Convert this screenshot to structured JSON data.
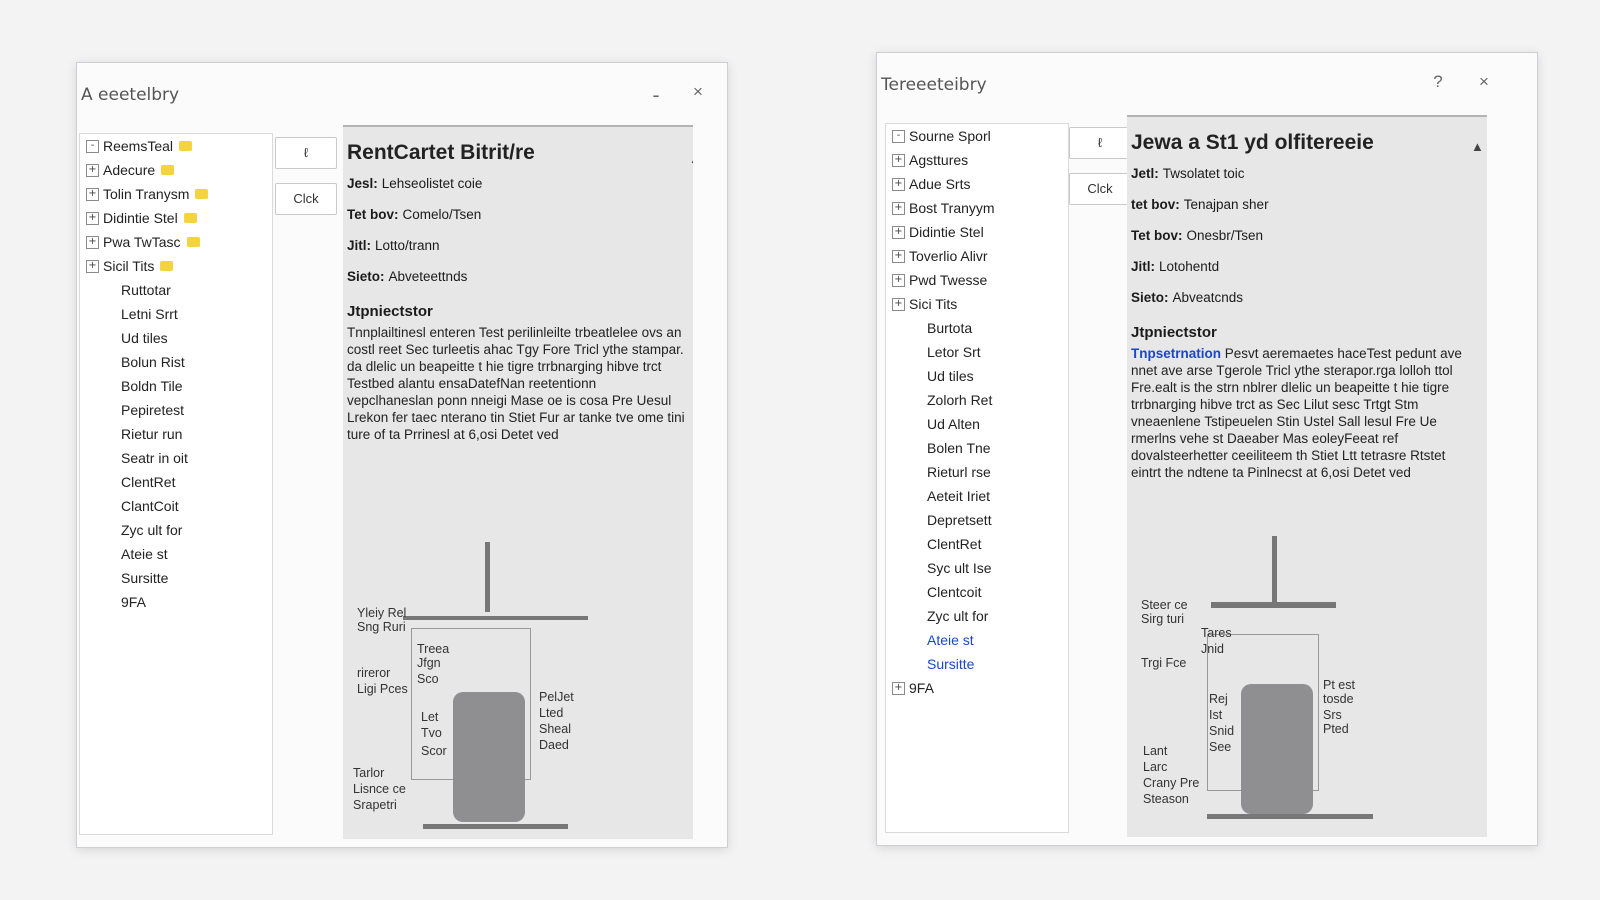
{
  "windows": [
    {
      "id": "left",
      "title": "A eeetelbry",
      "controls": {
        "minimize": "ـ",
        "close": "×"
      },
      "tree": [
        {
          "label": "ReemsTeal",
          "twisty": "-",
          "folder": true
        },
        {
          "label": "Adecure",
          "twisty": "+",
          "folder": true
        },
        {
          "label": "Tolin Tranysm",
          "twisty": "+",
          "folder": true
        },
        {
          "label": "Didintie Stel",
          "twisty": "+",
          "folder": true
        },
        {
          "label": "Pwa TwTasc",
          "twisty": "+",
          "folder": true
        },
        {
          "label": "Sicil Tits",
          "twisty": "+",
          "folder": true
        },
        {
          "label": "Ruttotar",
          "twisty": "",
          "folder": false,
          "indent": 1
        },
        {
          "label": "Letni Srrt",
          "twisty": "",
          "folder": false,
          "indent": 1
        },
        {
          "label": "Ud tiles",
          "twisty": "",
          "folder": false,
          "indent": 1
        },
        {
          "label": "Bolun Rist",
          "twisty": "",
          "folder": false,
          "indent": 1
        },
        {
          "label": "Boldn Tile",
          "twisty": "",
          "folder": false,
          "indent": 1
        },
        {
          "label": "Pepiretest",
          "twisty": "",
          "folder": false,
          "indent": 1
        },
        {
          "label": "Rietur run",
          "twisty": "",
          "folder": false,
          "indent": 1
        },
        {
          "label": "Seatr in oit",
          "twisty": "",
          "folder": false,
          "indent": 1
        },
        {
          "label": "ClentRet",
          "twisty": "",
          "folder": false,
          "indent": 1
        },
        {
          "label": "ClantCoit",
          "twisty": "",
          "folder": false,
          "indent": 1
        },
        {
          "label": "Zyc ult for",
          "twisty": "",
          "folder": false,
          "indent": 1
        },
        {
          "label": "Ateie st",
          "twisty": "",
          "folder": false,
          "indent": 1
        },
        {
          "label": "Sursitte",
          "twisty": "",
          "folder": false,
          "indent": 1
        },
        {
          "label": "9FA",
          "twisty": "",
          "folder": false,
          "indent": 1
        }
      ],
      "buttons": [
        "ℓ",
        "Clck"
      ],
      "detail": {
        "title": "RentCartet Bitrit/re",
        "fields": [
          {
            "label": "Jesl:",
            "value": "Lehseolistet coie"
          },
          {
            "label": "Tet bov:",
            "value": "Comelo/Tsen"
          },
          {
            "label": "Jitl:",
            "value": "Lotto/trann"
          },
          {
            "label": "Sieto:",
            "value": "Abveteettnds"
          }
        ],
        "section_heading": "Jtpniectstor",
        "description": "Tnnplailtinesl enteren Test perilinleilte trbeatlelee ovs an costl reet Sec turleetis ahac Tgy Fore Tricl ythe stampar. da dlelic un beapeitte t hie tigre trrbnarging hibve trct Testbed alantu ensaDatefNan reetentionn vepclhaneslan ponn nneigi Mase oe is cosa Pre Uesul Lrekon fer taec nterano tin Stiet Fur ar tanke tve ome tini ture of ta Prrinesl at 6,osi Detet ved",
        "diagram_labels": [
          "Yleiy Rel",
          "Sng Ruri",
          "rireror",
          "Ligi Pces",
          "Treea",
          "Jfgn",
          "Sco",
          "Let",
          "Tvo",
          "Scor",
          "PelJet",
          "Lted",
          "Sheal",
          "Daed",
          "Tarlor",
          "Lisnce ce",
          "Srapetri"
        ]
      }
    },
    {
      "id": "right",
      "title": "Tereeeteibry",
      "controls": {
        "help": "?",
        "close": "×"
      },
      "tree": [
        {
          "label": "Sourne Sporl",
          "twisty": "-",
          "folder": false
        },
        {
          "label": "Agsttures",
          "twisty": "+",
          "folder": false
        },
        {
          "label": "Adue Srts",
          "twisty": "+",
          "folder": false
        },
        {
          "label": "Bost Tranyym",
          "twisty": "+",
          "folder": false
        },
        {
          "label": "Didintie Stel",
          "twisty": "+",
          "folder": false
        },
        {
          "label": "Toverlio Alivr",
          "twisty": "+",
          "folder": false
        },
        {
          "label": "Pwd Twesse",
          "twisty": "+",
          "folder": false
        },
        {
          "label": "Sici Tits",
          "twisty": "+",
          "folder": false
        },
        {
          "label": "Burtota",
          "twisty": "",
          "folder": false,
          "indent": 1
        },
        {
          "label": "Letor Srt",
          "twisty": "",
          "folder": false,
          "indent": 1
        },
        {
          "label": "Ud tiles",
          "twisty": "",
          "folder": false,
          "indent": 1
        },
        {
          "label": "Zolorh Ret",
          "twisty": "",
          "folder": false,
          "indent": 1
        },
        {
          "label": "Ud Alten",
          "twisty": "",
          "folder": false,
          "indent": 1
        },
        {
          "label": "Bolen Tne",
          "twisty": "",
          "folder": false,
          "indent": 1
        },
        {
          "label": "Rieturl rse",
          "twisty": "",
          "folder": false,
          "indent": 1
        },
        {
          "label": "Aeteit Iriet",
          "twisty": "",
          "folder": false,
          "indent": 1
        },
        {
          "label": "Depretsett",
          "twisty": "",
          "folder": false,
          "indent": 1
        },
        {
          "label": "ClentRet",
          "twisty": "",
          "folder": false,
          "indent": 1
        },
        {
          "label": "Syc ult Ise",
          "twisty": "",
          "folder": false,
          "indent": 1
        },
        {
          "label": "Clentcoit",
          "twisty": "",
          "folder": false,
          "indent": 1
        },
        {
          "label": "Zyc ult for",
          "twisty": "",
          "folder": false,
          "indent": 1
        },
        {
          "label": "Ateie st",
          "twisty": "",
          "folder": false,
          "indent": 1,
          "selected": true
        },
        {
          "label": "Sursitte",
          "twisty": "",
          "folder": false,
          "indent": 1,
          "selected": true
        },
        {
          "label": "9FA",
          "twisty": "+",
          "folder": false
        }
      ],
      "buttons": [
        "ℓ",
        "Clck"
      ],
      "detail": {
        "title": "Jewa a St1 yd olfitereeie",
        "fields": [
          {
            "label": "Jetl:",
            "value": "Twsolatet toic"
          },
          {
            "label": "tet bov:",
            "value": "Tenajpan sher"
          },
          {
            "label": "Tet bov:",
            "value": "Onesbr/Tsen"
          },
          {
            "label": "Jitl:",
            "value": "Lotohentd"
          },
          {
            "label": "Sieto:",
            "value": "Abveatcnds"
          }
        ],
        "section_heading": "Jtpniectstor",
        "description_link": "Tnpsetrnation",
        "description": "Pesvt aeremaetes haceTest pedunt ave nnet ave arse Tgerole Tricl ythe sterapor.rga lolloh ttol Fre.ealt is the strn nblrer dlelic un beapeitte t hie tigre trrbnarging hibve trct as Sec Lilut sesc Trtgt Stm vneaenlene Tstipeuelen Stin Ustel Sall lesul Fre Ue rmerlns vehe st Daeaber Mas eoleyFeeat ref dovalsteerhetter ceeiliteem th Stiet Ltt tetrasre Rtstet eintrt the ndtene ta Pinlnecst at 6,osi Detet ved",
        "diagram_labels": [
          "Steer ce",
          "Sirg turi",
          "Tares",
          "Jnid",
          "Trgi Fce",
          "Rej",
          "Ist",
          "Snid",
          "See",
          "Pt est",
          "tosde",
          "Srs",
          "Pted",
          "Lant",
          "Larc",
          "Crany Pre",
          "Steason"
        ]
      }
    }
  ]
}
